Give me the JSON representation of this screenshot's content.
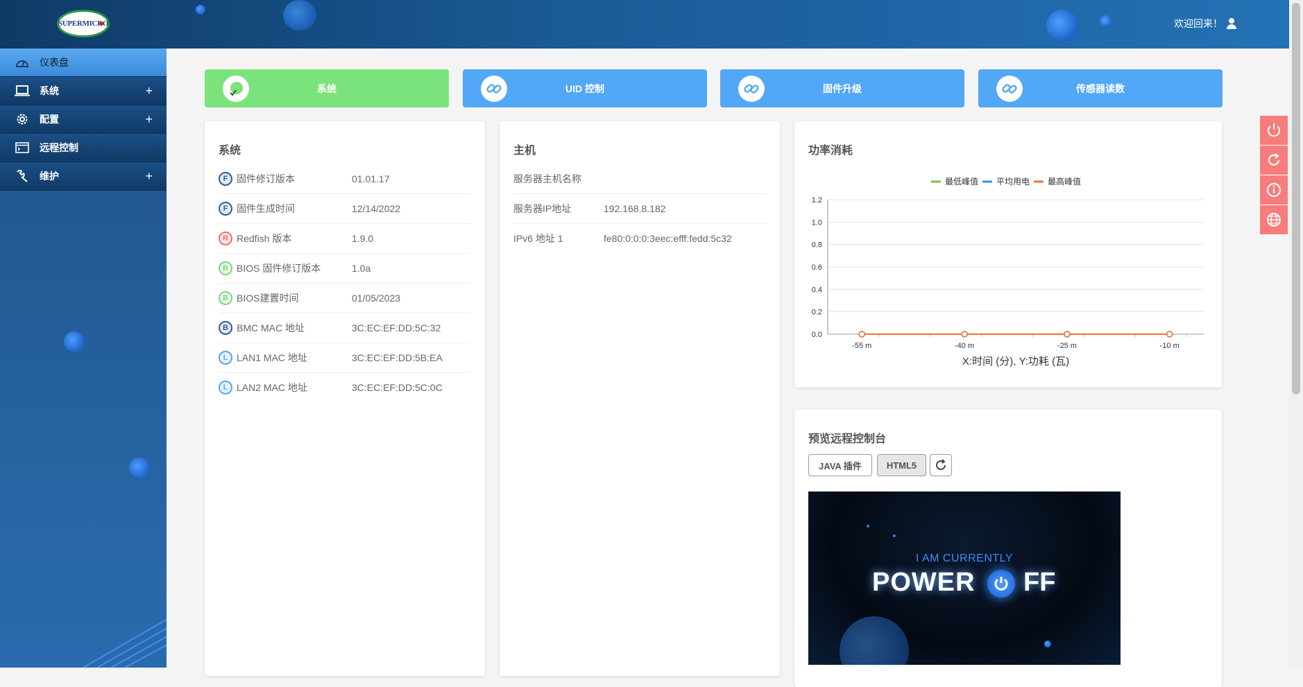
{
  "header": {
    "logo_text": "SUPERMICRO",
    "welcome_text": "欢迎回来！"
  },
  "sidebar": {
    "items": [
      {
        "label": "仪表盘",
        "icon": "gauge-icon",
        "active": true
      },
      {
        "label": "系统",
        "icon": "laptop-icon",
        "expand": "+"
      },
      {
        "label": "配置",
        "icon": "gear-icon",
        "expand": "+"
      },
      {
        "label": "远程控制",
        "icon": "console-icon"
      },
      {
        "label": "维护",
        "icon": "wrench-icon",
        "expand": "+"
      }
    ]
  },
  "tiles": [
    {
      "label": "系统",
      "color": "#7be37b",
      "icon": "health-check-icon"
    },
    {
      "label": "UID 控制",
      "color": "#52a7f7",
      "icon": "link-icon"
    },
    {
      "label": "固件升级",
      "color": "#52a7f7",
      "icon": "link-icon"
    },
    {
      "label": "传感器读数",
      "color": "#52a7f7",
      "icon": "link-icon"
    }
  ],
  "system_card": {
    "title": "系统",
    "rows": [
      {
        "badge": "F",
        "badge_color": "#2f5b9a",
        "label": "固件修订版本",
        "value": "01.01.17"
      },
      {
        "badge": "F",
        "badge_color": "#2f5b9a",
        "label": "固件生成时间",
        "value": "12/14/2022"
      },
      {
        "badge": "R",
        "badge_color": "#f26c6c",
        "label": "Redfish 版本",
        "value": "1.9.0"
      },
      {
        "badge": "B",
        "badge_color": "#7bd67b",
        "label": "BIOS 固件修订版本",
        "value": "1.0a"
      },
      {
        "badge": "B",
        "badge_color": "#7bd67b",
        "label": "BIOS建置时间",
        "value": "01/05/2023"
      },
      {
        "badge": "B",
        "badge_color": "#2f5b9a",
        "label": "BMC MAC 地址",
        "value": "3C:EC:EF:DD:5C:32"
      },
      {
        "badge": "L",
        "badge_color": "#52a7f7",
        "label": "LAN1 MAC 地址",
        "value": "3C:EC:EF:DD:5B:EA"
      },
      {
        "badge": "L",
        "badge_color": "#52a7f7",
        "label": "LAN2 MAC 地址",
        "value": "3C:EC:EF:DD:5C:0C"
      }
    ]
  },
  "host_card": {
    "title": "主机",
    "rows": [
      {
        "label": "服务器主机名称",
        "value": ""
      },
      {
        "label": "服务器IP地址",
        "value": "192.168.8.182"
      },
      {
        "label": "IPv6 地址 1",
        "value": "fe80:0:0:0:3eec:efff:fedd:5c32"
      }
    ]
  },
  "power_card": {
    "title": "功率消耗"
  },
  "chart_data": {
    "type": "line",
    "x": [
      -55,
      -40,
      -25,
      -10
    ],
    "categories": [
      "-55 m",
      "-40 m",
      "-25 m",
      "-10 m"
    ],
    "series": [
      {
        "name": "最低峰值",
        "color": "#7ac142",
        "values": [
          0,
          0,
          0,
          0
        ]
      },
      {
        "name": "平均用电",
        "color": "#3a8ee6",
        "values": [
          0,
          0,
          0,
          0
        ]
      },
      {
        "name": "最高峰值",
        "color": "#f07030",
        "values": [
          0,
          0,
          0,
          0
        ]
      }
    ],
    "ylim": [
      0,
      1.2
    ],
    "yticks": [
      "1.2",
      "1.0",
      "0.8",
      "0.6",
      "0.4",
      "0.2",
      "0.0"
    ],
    "xlabel": "X:时间 (分), Y:功耗 (瓦)",
    "legend": "top-center",
    "grid": true
  },
  "console_card": {
    "title": "预览远程控制台",
    "java_label": "JAVA 插件",
    "html5_label": "HTML5",
    "preview_sub": "I AM CURRENTLY",
    "preview_main": "POWER",
    "preview_off": "FF"
  },
  "quick_buttons": [
    "power-icon",
    "refresh-icon",
    "info-icon",
    "globe-icon"
  ]
}
